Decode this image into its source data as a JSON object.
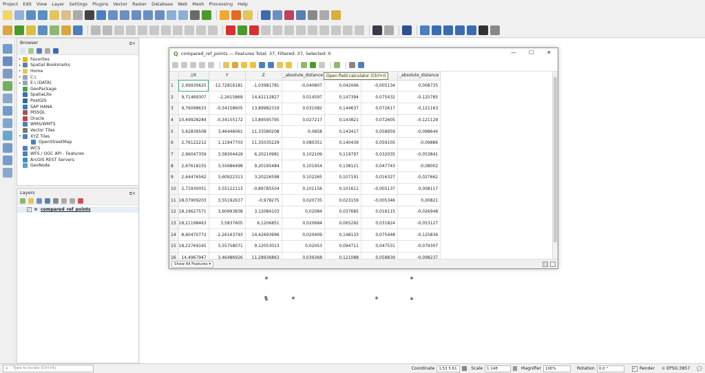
{
  "menu": [
    "Project",
    "Edit",
    "View",
    "Layer",
    "Settings",
    "Plugins",
    "Vector",
    "Raster",
    "Database",
    "Web",
    "Mesh",
    "Processing",
    "Help"
  ],
  "browser": {
    "title": "Browser",
    "items": [
      {
        "label": "Favorites",
        "icon": "star-icon",
        "color": "#e6b800",
        "arrow": "▸"
      },
      {
        "label": "Spatial Bookmarks",
        "icon": "bookmark-icon",
        "color": "#5a7fb0",
        "arrow": "▸"
      },
      {
        "label": "Home",
        "icon": "folder-icon",
        "color": "#e3c45e",
        "arrow": "▸"
      },
      {
        "label": "C:\\",
        "icon": "drive-icon",
        "color": "#9aa4b0",
        "arrow": "▸"
      },
      {
        "label": "E:\\ (DATA)",
        "icon": "drive-icon",
        "color": "#9aa4b0",
        "arrow": "▸"
      },
      {
        "label": "GeoPackage",
        "icon": "geopackage-icon",
        "color": "#4aa34a",
        "arrow": ""
      },
      {
        "label": "SpatiaLite",
        "icon": "spatialite-icon",
        "color": "#3b6cb0",
        "arrow": ""
      },
      {
        "label": "PostGIS",
        "icon": "postgis-icon",
        "color": "#336699",
        "arrow": ""
      },
      {
        "label": "SAP HANA",
        "icon": "database-icon",
        "color": "#2f7fc0",
        "arrow": ""
      },
      {
        "label": "MSSQL",
        "icon": "database-icon",
        "color": "#b05050",
        "arrow": ""
      },
      {
        "label": "Oracle",
        "icon": "database-icon",
        "color": "#c04040",
        "arrow": ""
      },
      {
        "label": "WMS/WMTS",
        "icon": "globe-icon",
        "color": "#4b7fbf",
        "arrow": ""
      },
      {
        "label": "Vector Tiles",
        "icon": "grid-icon",
        "color": "#777777",
        "arrow": ""
      },
      {
        "label": "XYZ Tiles",
        "icon": "grid-icon",
        "color": "#4b7fbf",
        "arrow": "▾"
      },
      {
        "label": "OpenStreetMap",
        "icon": "grid-icon",
        "color": "#4b7fbf",
        "arrow": "",
        "indent": true
      },
      {
        "label": "WCS",
        "icon": "globe-icon",
        "color": "#4b7fbf",
        "arrow": ""
      },
      {
        "label": "WFS / OGC API - Features",
        "icon": "globe-icon",
        "color": "#4b7fbf",
        "arrow": ""
      },
      {
        "label": "ArcGIS REST Servers",
        "icon": "globe-icon",
        "color": "#3b8fc0",
        "arrow": ""
      },
      {
        "label": "GeoNode",
        "icon": "geonode-icon",
        "color": "#5aa0d0",
        "arrow": ""
      }
    ]
  },
  "layers": {
    "title": "Layers",
    "items": [
      {
        "label": "compared_ref_points",
        "checked": "✓"
      }
    ]
  },
  "attribute_table": {
    "title": "compared_ref_points — Features Total: 37, Filtered: 37, Selected: 0",
    "tooltip": "Open field calculator (Ctrl+I)",
    "columns": [
      "//X",
      "Y",
      "Z",
      "_absolute_distance",
      "",
      "distance",
      "_absolute_distance"
    ],
    "rows": [
      [
        "1",
        "2,69930625",
        "-12,72816181",
        "-1,03981781",
        "-0,040807",
        "0,042046",
        "-0,005134",
        "0,008735"
      ],
      [
        "2",
        "9,71469307",
        "-2,2615869",
        "14,42112827",
        "0,014597",
        "0,147394",
        "0,075432",
        "-0,125785"
      ],
      [
        "3",
        "9,76098633",
        "-0,34158605",
        "13,89982319",
        "0,031082",
        "0,144637",
        "0,072617",
        "-0,121163"
      ],
      [
        "4",
        "10,49928284",
        "-0,34155172",
        "13,89595795",
        "0,027217",
        "0,143821",
        "0,072605",
        "-0,121129"
      ],
      [
        "5",
        "5,62839508",
        "3,46446061",
        "11,33580208",
        "0,0858",
        "0,143417",
        "0,058959",
        "-0,098644"
      ],
      [
        "6",
        "2,76122212",
        "1,11947703",
        "11,35035229",
        "0,080351",
        "0,140439",
        "0,059105",
        "-0,09886"
      ],
      [
        "7",
        "2,66047359",
        "3,58304429",
        "6,20210981",
        "0,102109",
        "0,119797",
        "0,032035",
        "-0,053841"
      ],
      [
        "8",
        "2,67618155",
        "3,55686498",
        "9,20195484",
        "0,101954",
        "0,138121",
        "0,047743",
        "-0,08002"
      ],
      [
        "9",
        "2,64476562",
        "3,60922313",
        "3,20226598",
        "0,102265",
        "0,107191",
        "0,016327",
        "-0,027662"
      ],
      [
        "10",
        "2,71930051",
        "3,55122113",
        "-0,89785504",
        "0,101156",
        "0,101611",
        "-0,005137",
        "0,008117"
      ],
      [
        "11",
        "18,07909203",
        "3,55192637",
        "-0,978275",
        "0,020735",
        "0,023159",
        "-0,005346",
        "0,00821"
      ],
      [
        "12",
        "18,19627571",
        "3,60993838",
        "3,12084103",
        "0,02084",
        "0,037685",
        "0,016115",
        "-0,026948"
      ],
      [
        "13",
        "18,21198463",
        "3,5837605",
        "6,1206851",
        "0,020684",
        "0,065292",
        "0,031824",
        "-0,053127"
      ],
      [
        "14",
        "8,60470772",
        "-2,26163793",
        "14,42693996",
        "0,020409",
        "0,148133",
        "0,075448",
        "-0,125836"
      ],
      [
        "15",
        "18,22769165",
        "3,55758071",
        "9,12053013",
        "0,02053",
        "0,094711",
        "0,047531",
        "-0,079307"
      ],
      [
        "16",
        "14,4967947",
        "3,46486926",
        "11,28936863",
        "0,039368",
        "0,121088",
        "0,058839",
        "-0,098237"
      ]
    ],
    "show_all": "Show All Features"
  },
  "status": {
    "locator_placeholder": "Type to locate (Ctrl+K)",
    "coordinate_label": "Coordinate",
    "coordinate_value": "1,53 5,61",
    "scale_label": "Scale",
    "scale_value": "1:148",
    "magnifier_label": "Magnifier",
    "magnifier_value": "100%",
    "rotation_label": "Rotation",
    "rotation_value": "0,0 °",
    "render_label": "Render",
    "render_checked": "✓",
    "crs": "EPSG:3857"
  }
}
